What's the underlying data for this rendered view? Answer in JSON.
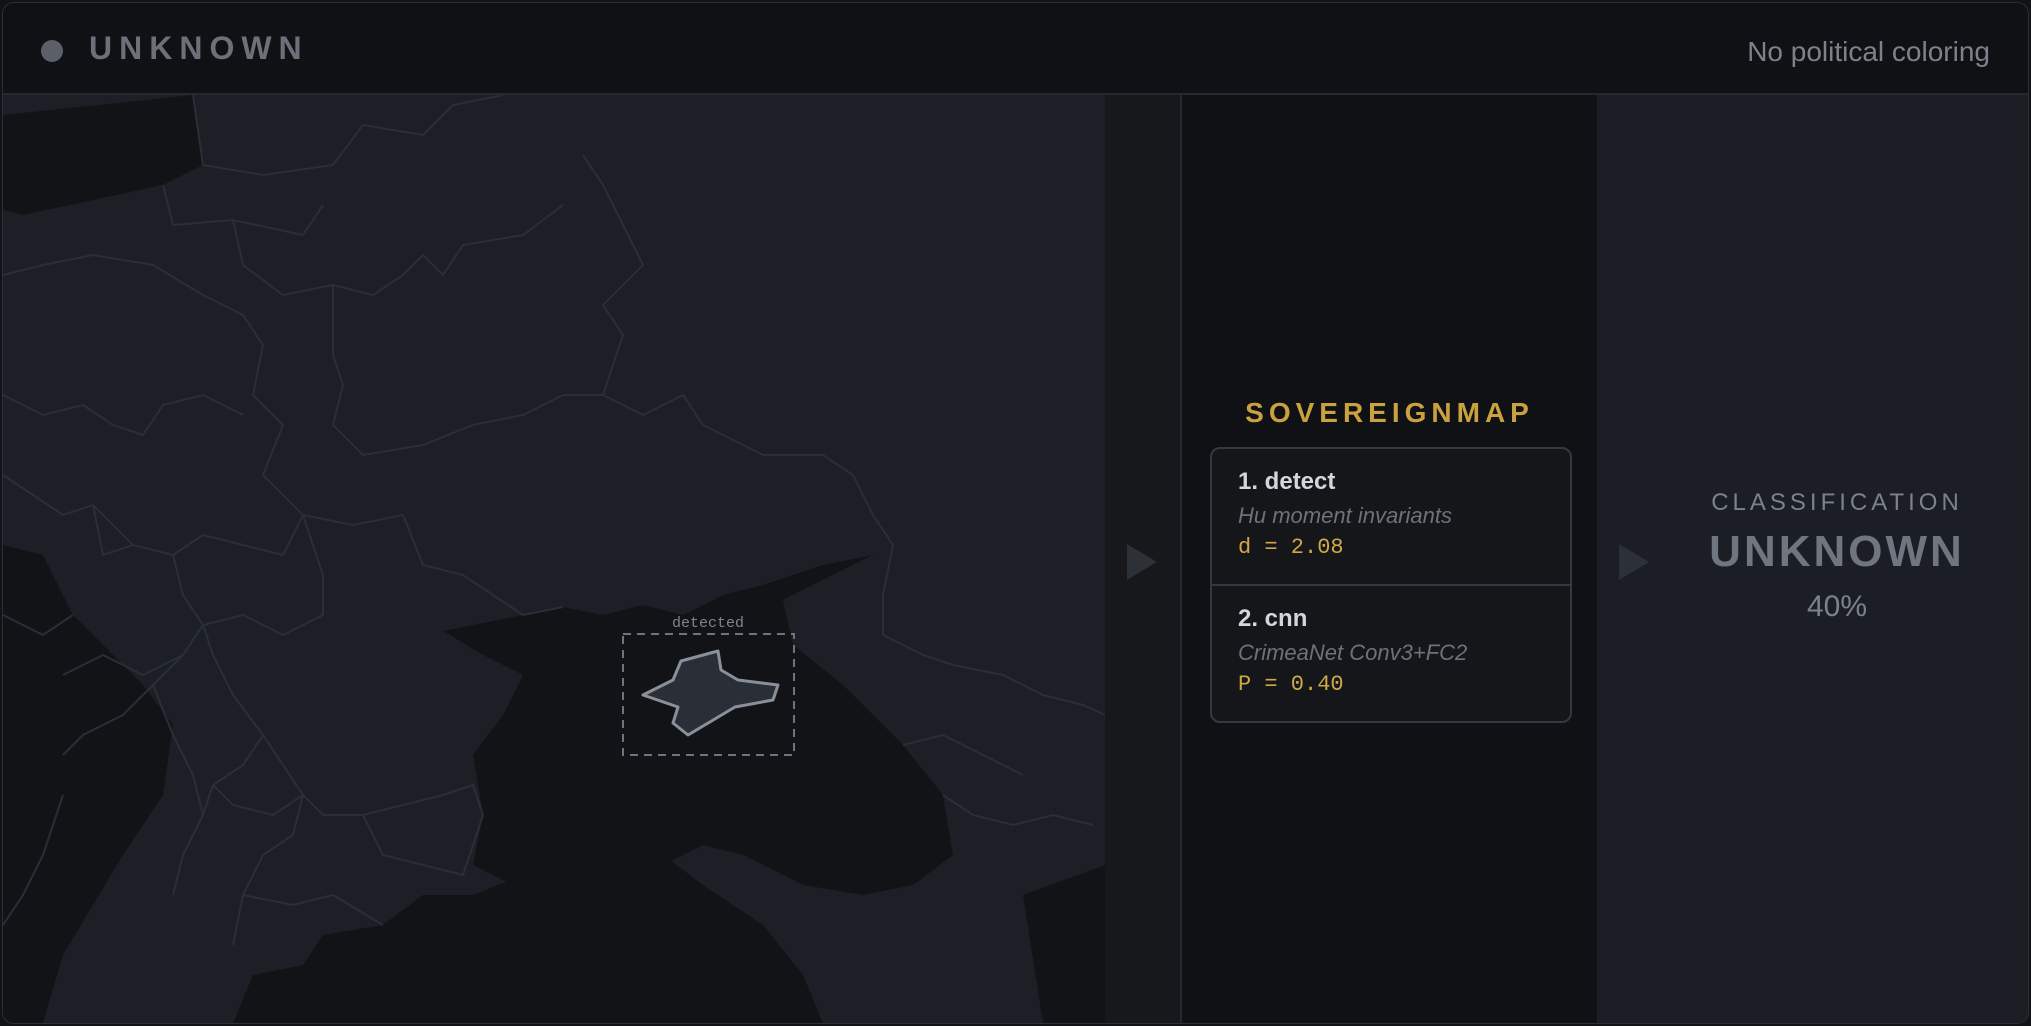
{
  "header": {
    "status_title": "UNKNOWN",
    "note": "No political coloring"
  },
  "map": {
    "detected_label": "detected",
    "colors": {
      "land": "#1c1f26",
      "sea": "#111317",
      "borders": "#2a2e36",
      "highlight": "#8a9099"
    }
  },
  "pipeline": {
    "brand": "SOVEREIGNMAP",
    "steps": [
      {
        "title": "1. detect",
        "description": "Hu moment invariants",
        "value": "d = 2.08"
      },
      {
        "title": "2. cnn",
        "description": "CrimeaNet Conv3+FC2",
        "value": "P = 0.40"
      }
    ]
  },
  "classification": {
    "label": "CLASSIFICATION",
    "value": "UNKNOWN",
    "confidence": "40%"
  },
  "colors": {
    "accent": "#c9a13f",
    "value": "#d1a844"
  },
  "icons": [
    "status-dot-icon",
    "play-arrow-icon"
  ]
}
